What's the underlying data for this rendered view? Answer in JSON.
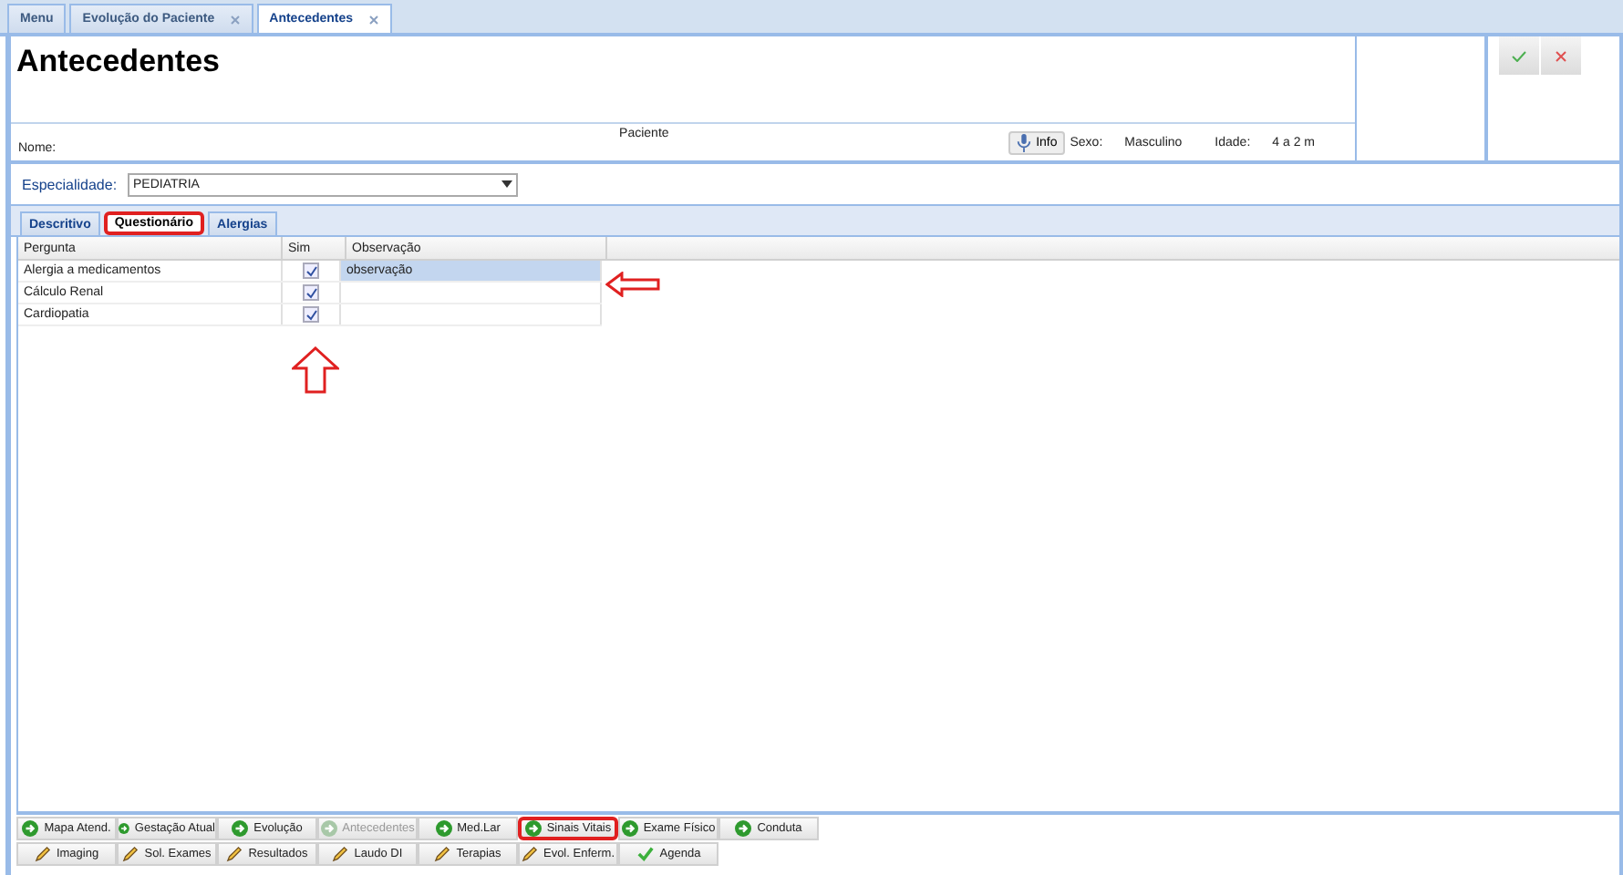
{
  "tabs": [
    {
      "label": "Menu",
      "closable": false,
      "selected": false
    },
    {
      "label": "Evolução do Paciente",
      "closable": true,
      "selected": false
    },
    {
      "label": "Antecedentes",
      "closable": true,
      "selected": true
    }
  ],
  "header": {
    "title": "Antecedentes",
    "name_label": "Nome:",
    "patient": "Paciente",
    "info_button": "Info",
    "sex_label": "Sexo:",
    "sex": "Masculino",
    "age_label": "Idade:",
    "age": "4 a 2 m"
  },
  "specialty": {
    "label": "Especialidade:",
    "value": "PEDIATRIA"
  },
  "subtabs": [
    {
      "label": "Descritivo",
      "selected": false,
      "highlighted": false
    },
    {
      "label": "Questionário",
      "selected": true,
      "highlighted": true
    },
    {
      "label": "Alergias",
      "selected": false,
      "highlighted": false
    }
  ],
  "table": {
    "columns": [
      "Pergunta",
      "Sim",
      "Observação"
    ],
    "rows": [
      {
        "question": "Alergia a medicamentos",
        "checked": true,
        "note": "observação",
        "selected": true
      },
      {
        "question": "Cálculo Renal",
        "checked": true,
        "note": "",
        "selected": false
      },
      {
        "question": "Cardiopatia",
        "checked": true,
        "note": "",
        "selected": false
      }
    ]
  },
  "buttons": [
    [
      {
        "label": "Mapa Atend.",
        "kind": "go",
        "disabled": false,
        "highlighted": false
      },
      {
        "label": "Gestação Atual",
        "kind": "go",
        "disabled": false,
        "highlighted": false
      },
      {
        "label": "Evolução",
        "kind": "go",
        "disabled": false,
        "highlighted": false
      },
      {
        "label": "Antecedentes",
        "kind": "go",
        "disabled": true,
        "highlighted": false
      },
      {
        "label": "Med.Lar",
        "kind": "go",
        "disabled": false,
        "highlighted": false
      },
      {
        "label": "Sinais Vitais",
        "kind": "go",
        "disabled": false,
        "highlighted": true
      },
      {
        "label": "Exame Físico",
        "kind": "go",
        "disabled": false,
        "highlighted": false
      },
      {
        "label": "Conduta",
        "kind": "go",
        "disabled": false,
        "highlighted": false
      }
    ],
    [
      {
        "label": "Imaging",
        "kind": "pencil",
        "disabled": false,
        "highlighted": false
      },
      {
        "label": "Sol. Exames",
        "kind": "pencil",
        "disabled": false,
        "highlighted": false
      },
      {
        "label": "Resultados",
        "kind": "pencil",
        "disabled": false,
        "highlighted": false
      },
      {
        "label": "Laudo DI",
        "kind": "pencil",
        "disabled": false,
        "highlighted": false
      },
      {
        "label": "Terapias",
        "kind": "pencil",
        "disabled": false,
        "highlighted": false
      },
      {
        "label": "Evol. Enferm.",
        "kind": "pencil",
        "disabled": false,
        "highlighted": false
      },
      {
        "label": "Agenda",
        "kind": "check",
        "disabled": false,
        "highlighted": false
      }
    ]
  ]
}
